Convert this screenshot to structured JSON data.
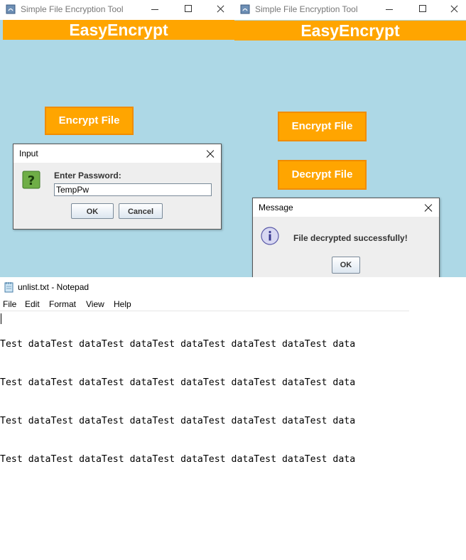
{
  "left_window": {
    "title": "Simple File Encryption Tool",
    "banner": "EasyEncrypt",
    "encrypt_button": "Encrypt File",
    "dialog": {
      "title": "Input",
      "prompt": "Enter Password:",
      "password_value": "TempPw",
      "ok": "OK",
      "cancel": "Cancel"
    }
  },
  "right_window": {
    "title": "Simple File Encryption Tool",
    "banner": "EasyEncrypt",
    "encrypt_button": "Encrypt File",
    "decrypt_button": "Decrypt File",
    "dialog": {
      "title": "Message",
      "message": "File decrypted successfully!",
      "ok": "OK"
    }
  },
  "notepad": {
    "title": "unlist.txt - Notepad",
    "menu": [
      "File",
      "Edit",
      "Format",
      "View",
      "Help"
    ],
    "lines": [
      "Test dataTest dataTest dataTest dataTest dataTest dataTest data",
      "Test dataTest dataTest dataTest dataTest dataTest dataTest data",
      "Test dataTest dataTest dataTest dataTest dataTest dataTest data",
      "Test dataTest dataTest dataTest dataTest dataTest dataTest data"
    ]
  },
  "colors": {
    "window_bg": "#add8e6",
    "accent_orange": "#ffa500",
    "dialog_bg": "#eeeeee"
  }
}
